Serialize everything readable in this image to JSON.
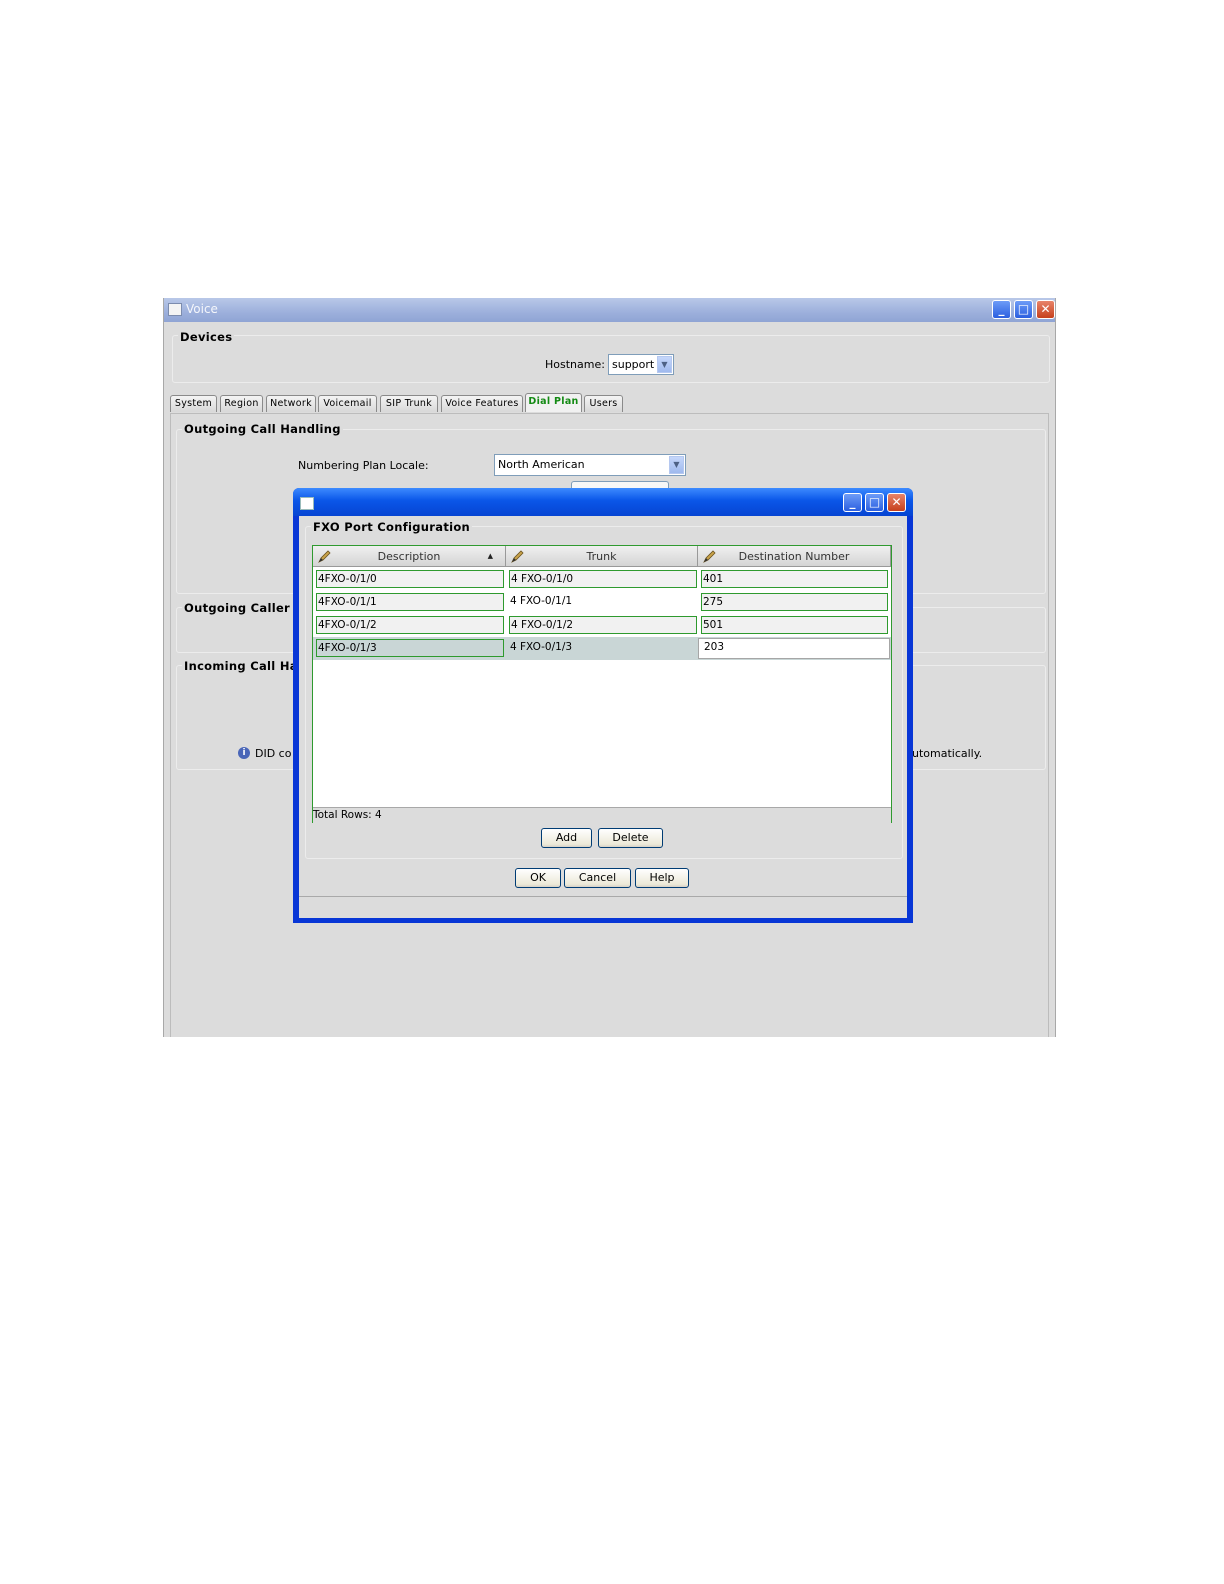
{
  "main_window": {
    "title": "Voice",
    "devices": {
      "group_title": "Devices",
      "hostname_label": "Hostname:",
      "hostname_value": "support"
    },
    "tabs": [
      {
        "label": "System"
      },
      {
        "label": "Region"
      },
      {
        "label": "Network"
      },
      {
        "label": "Voicemail"
      },
      {
        "label": "SIP Trunk"
      },
      {
        "label": "Voice Features"
      },
      {
        "label": "Dial Plan",
        "active": true
      },
      {
        "label": "Users"
      }
    ],
    "outgoing": {
      "group_title": "Outgoing Call Handling",
      "locale_label": "Numbering Plan Locale:",
      "locale_value": "North American"
    },
    "outgoing_caller_partial": "Outgoing Caller Id",
    "incoming_partial": "Incoming Call Har",
    "info_left_partial": "DID co",
    "info_right_partial": "utomatically."
  },
  "dialog": {
    "group_title": "FXO Port Configuration",
    "columns": [
      "Description",
      "Trunk",
      "Destination Number"
    ],
    "rows": [
      {
        "description": "4FXO-0/1/0",
        "trunk": "4 FXO-0/1/0",
        "destination": "401"
      },
      {
        "description": "4FXO-0/1/1",
        "trunk": "4 FXO-0/1/1",
        "destination": "275"
      },
      {
        "description": "4FXO-0/1/2",
        "trunk": "4 FXO-0/1/2",
        "destination": "501"
      },
      {
        "description": "4FXO-0/1/3",
        "trunk": "4 FXO-0/1/3",
        "destination": "203"
      }
    ],
    "total_rows": "Total Rows: 4",
    "add_label": "Add",
    "delete_label": "Delete",
    "ok_label": "OK",
    "cancel_label": "Cancel",
    "help_label": "Help"
  },
  "colors": {
    "dialog_frame": "#0836d6",
    "grid_border": "#2f9a2f",
    "active_tab_text": "#138a13",
    "selected_row": "#c9d6d6"
  },
  "icons": {
    "column_edit": "pencil-icon",
    "info": "info-icon",
    "sort": "sort-ascending-icon"
  }
}
